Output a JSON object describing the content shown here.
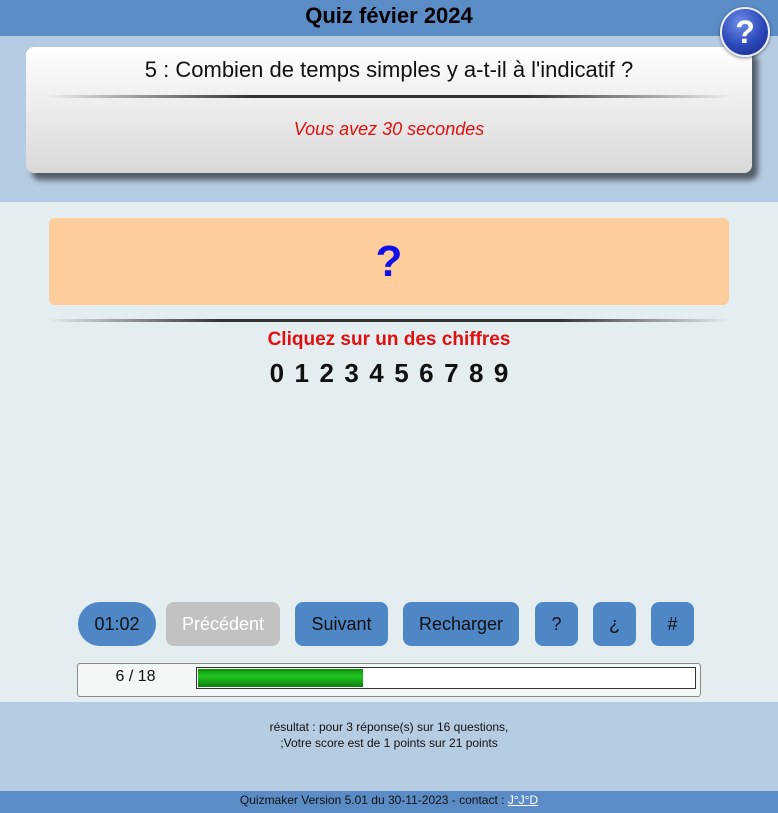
{
  "header": {
    "title": "Quiz févier 2024",
    "help_icon": "question-badge-icon",
    "help_glyph": "?"
  },
  "question": {
    "text": "5 : Combien de temps simples y a-t-il à l'indicatif ?",
    "time_notice": "Vous avez 30 secondes"
  },
  "answer": {
    "placeholder": "?"
  },
  "instruction": "Cliquez sur un des chiffres",
  "digits": [
    "0",
    "1",
    "2",
    "3",
    "4",
    "5",
    "6",
    "7",
    "8",
    "9"
  ],
  "controls": {
    "timer": "01:02",
    "previous": "Précédent",
    "next": "Suivant",
    "reload": "Recharger",
    "help": "?",
    "inverted_question": "¿",
    "hash": "#"
  },
  "progress": {
    "label": "6 / 18",
    "current": 6,
    "total": 18,
    "fill_fraction": 0.333,
    "fill_color": "#1aa81a"
  },
  "result": {
    "line1": "résultat : pour 3 réponse(s) sur 16 questions,",
    "line2": ";Votre score est de 1 points sur 21 points"
  },
  "footer": {
    "text": "Quizmaker Version 5.01 du 30-11-2023 - contact : ",
    "link_label": "J°J°D"
  },
  "colors": {
    "title_bar": "#5b8cc6",
    "band": "#b6cce2",
    "answer_box": "#fdcd9b",
    "button": "#4f86c6",
    "button_disabled": "#c2c2c2",
    "alert_text": "#e01010"
  }
}
